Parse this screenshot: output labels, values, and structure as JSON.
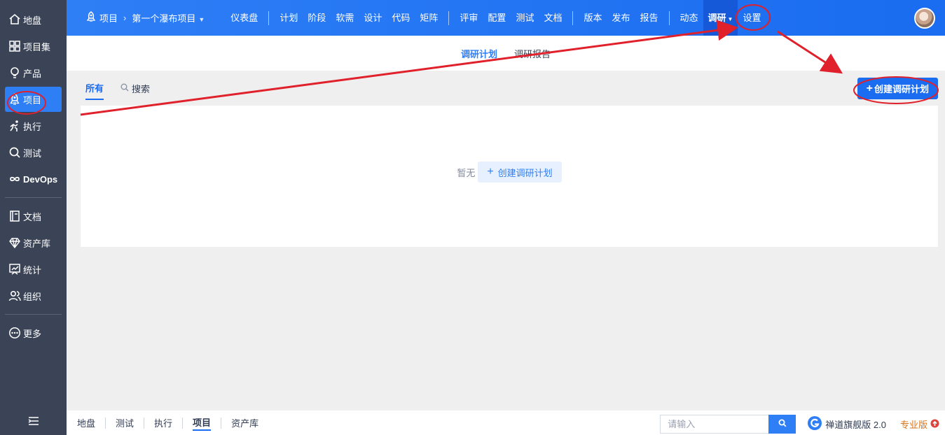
{
  "sidebar": {
    "items": [
      {
        "label": "地盘",
        "icon": "home-icon"
      },
      {
        "label": "项目集",
        "icon": "grid-icon"
      },
      {
        "label": "产品",
        "icon": "bulb-icon"
      },
      {
        "label": "项目",
        "icon": "rocket-icon",
        "active": true
      },
      {
        "label": "执行",
        "icon": "run-icon"
      },
      {
        "label": "测试",
        "icon": "search-icon"
      },
      {
        "label": "DevOps",
        "icon": "infinity-icon"
      },
      {
        "label": "文档",
        "icon": "book-icon"
      },
      {
        "label": "资产库",
        "icon": "diamond-icon"
      },
      {
        "label": "统计",
        "icon": "chart-icon"
      },
      {
        "label": "组织",
        "icon": "user-icon"
      },
      {
        "label": "更多",
        "icon": "more-icon"
      }
    ],
    "collapse_icon": "menu-collapse-icon"
  },
  "header": {
    "module": "项目",
    "project_name": "第一个瀑布项目",
    "nav_groups": [
      [
        "仪表盘"
      ],
      [
        "计划",
        "阶段",
        "软需",
        "设计",
        "代码",
        "矩阵"
      ],
      [
        "评审",
        "配置",
        "测试",
        "文档"
      ],
      [
        "版本",
        "发布",
        "报告"
      ],
      [
        "动态",
        "调研",
        "设置"
      ]
    ],
    "active_nav": "调研"
  },
  "subnav": {
    "items": [
      "调研计划",
      "调研报告"
    ],
    "active": "调研计划"
  },
  "toolbar": {
    "tab_all": "所有",
    "search_label": "搜索",
    "create_label": "创建调研计划"
  },
  "empty_state": {
    "text": "暂无",
    "button_label": "创建调研计划"
  },
  "footer": {
    "nav": [
      "地盘",
      "测试",
      "执行",
      "项目",
      "资产库"
    ],
    "active": "项目",
    "search_placeholder": "请输入",
    "brand": "禅道旗舰版 2.0",
    "edition": "专业版"
  },
  "colors": {
    "accent": "#2e7ef6",
    "sidebar_bg": "#3b4457",
    "annotation": "#e0202a",
    "edition": "#d6741b"
  }
}
